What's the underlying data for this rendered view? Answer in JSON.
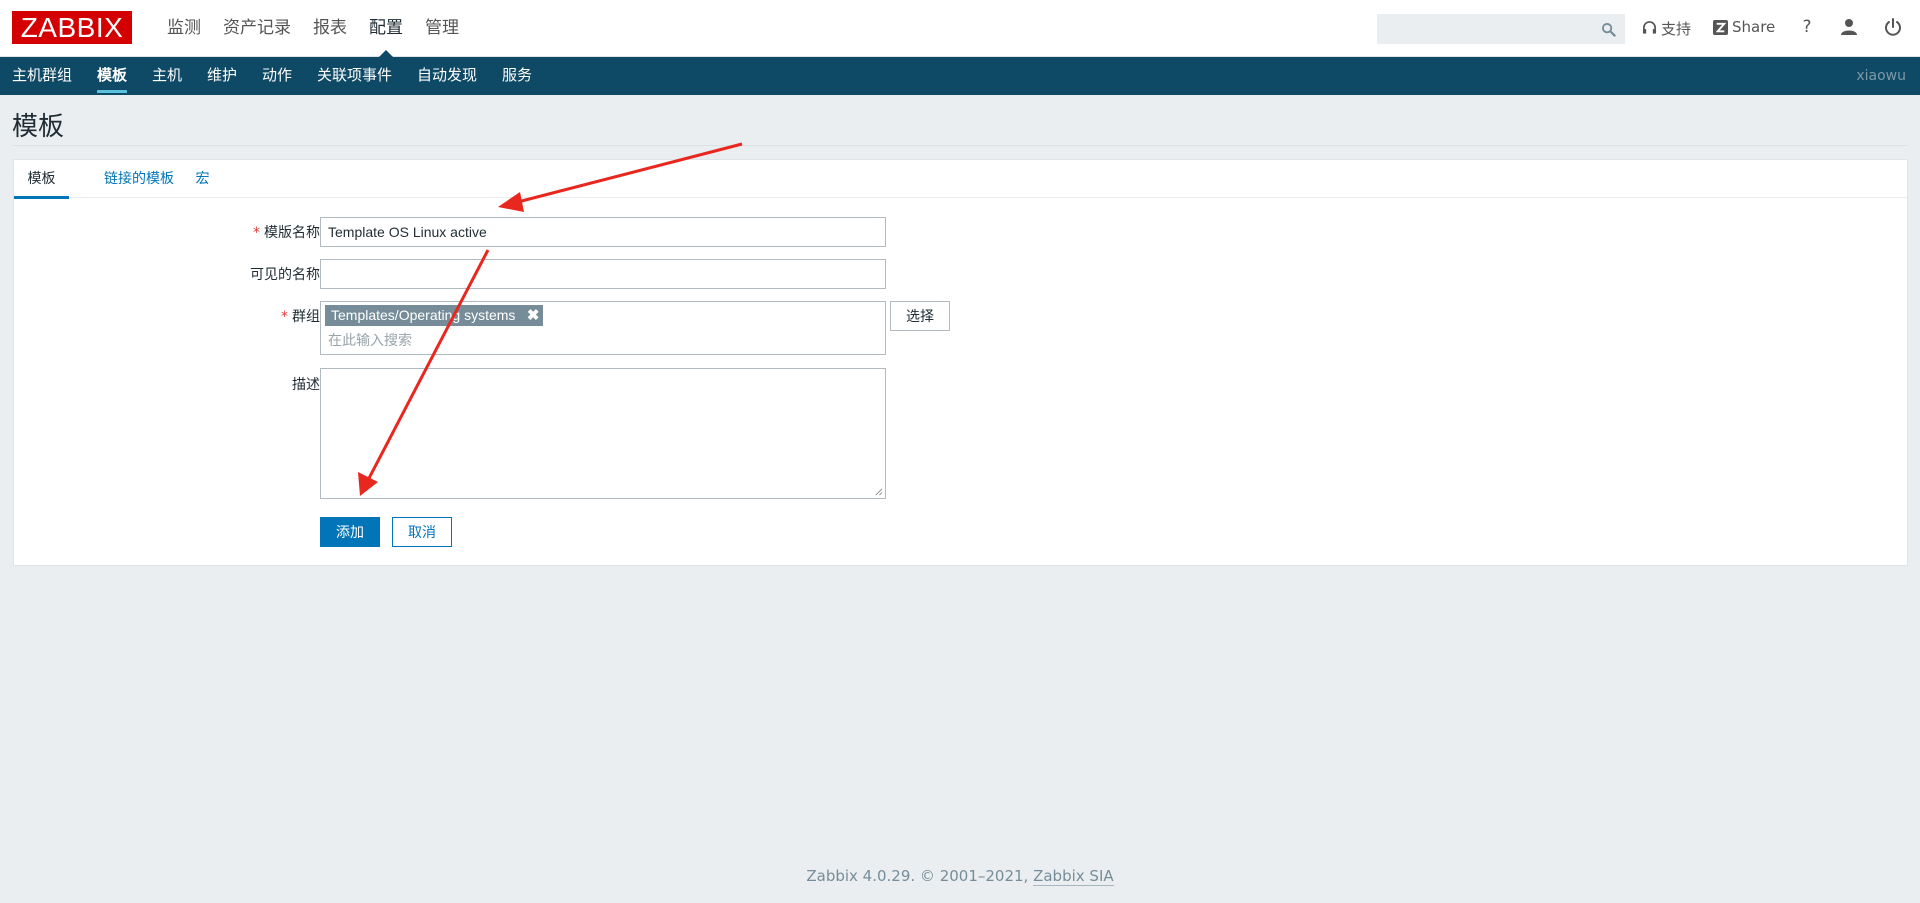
{
  "header": {
    "logo": "ZABBIX",
    "menu": [
      "监测",
      "资产记录",
      "报表",
      "配置",
      "管理"
    ],
    "active_menu": "配置",
    "search_value": "",
    "support_label": "支持",
    "share_label": "Share",
    "help_label": "?"
  },
  "subnav": {
    "items": [
      "主机群组",
      "模板",
      "主机",
      "维护",
      "动作",
      "关联项事件",
      "自动发现",
      "服务"
    ],
    "active": "模板",
    "user": "xiaowu"
  },
  "page": {
    "title": "模板"
  },
  "tabs": [
    "模板",
    "链接的模板",
    "宏"
  ],
  "form": {
    "template_name_label": "模版名称",
    "template_name_value": "Template OS Linux active",
    "visible_name_label": "可见的名称",
    "visible_name_value": "",
    "groups_label": "群组",
    "group_tag": "Templates/Operating systems",
    "groups_placeholder": "在此输入搜索",
    "select_button": "选择",
    "description_label": "描述",
    "description_value": "",
    "add_button": "添加",
    "cancel_button": "取消"
  },
  "footer": {
    "text": "Zabbix 4.0.29. © 2001–2021, ",
    "link": "Zabbix SIA"
  },
  "colors": {
    "brand_red": "#d40000",
    "nav_bg": "#0e4965",
    "accent_blue": "#0275b8",
    "annotation_arrow": "#e8271e"
  }
}
